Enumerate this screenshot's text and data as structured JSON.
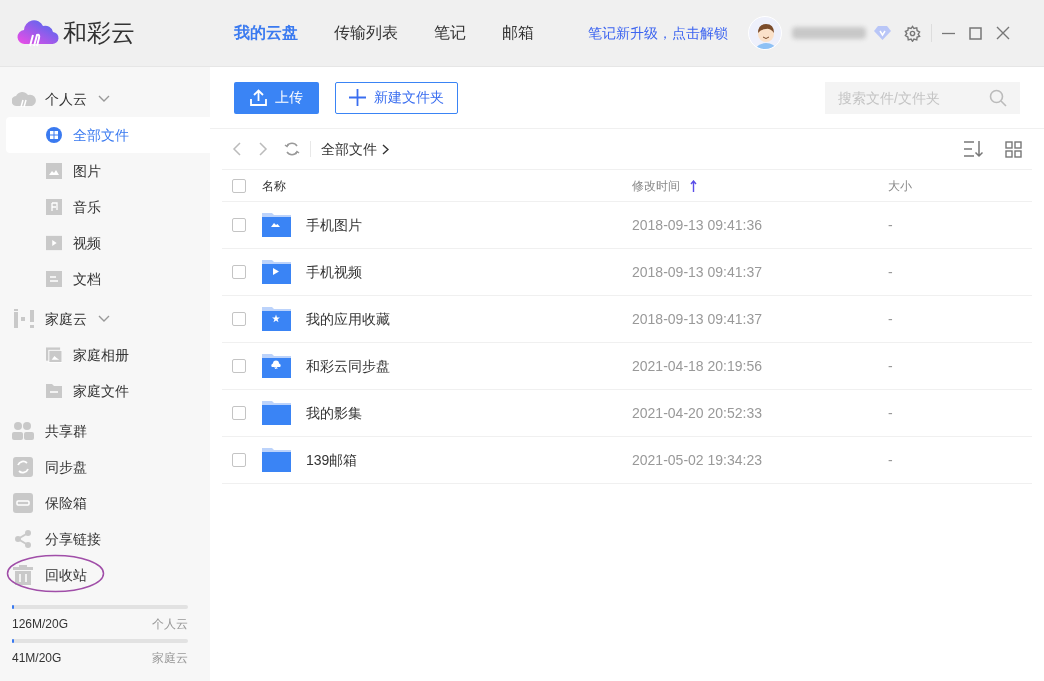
{
  "app": {
    "name": "和彩云"
  },
  "nav_tabs": [
    {
      "label": "我的云盘",
      "selected": true
    },
    {
      "label": "传输列表",
      "selected": false
    },
    {
      "label": "笔记",
      "selected": false
    },
    {
      "label": "邮箱",
      "selected": false
    }
  ],
  "promo_link": "笔记新升级，点击解锁",
  "sidebar": {
    "sections": [
      {
        "kind": "group",
        "label": "个人云",
        "expanded": true,
        "children": [
          {
            "label": "全部文件",
            "selected": true
          },
          {
            "label": "图片",
            "selected": false
          },
          {
            "label": "音乐",
            "selected": false
          },
          {
            "label": "视频",
            "selected": false
          },
          {
            "label": "文档",
            "selected": false
          }
        ]
      },
      {
        "kind": "group",
        "label": "家庭云",
        "expanded": true,
        "children": [
          {
            "label": "家庭相册",
            "selected": false
          },
          {
            "label": "家庭文件",
            "selected": false
          }
        ]
      },
      {
        "kind": "item",
        "label": "共享群",
        "selected": false
      },
      {
        "kind": "item",
        "label": "同步盘",
        "selected": false
      },
      {
        "kind": "item",
        "label": "保险箱",
        "selected": false
      },
      {
        "kind": "item",
        "label": "分享链接",
        "selected": false
      },
      {
        "kind": "item",
        "label": "回收站",
        "selected": false
      }
    ],
    "storage": [
      {
        "usage": "126M/20G",
        "label": "个人云",
        "level": 0.01
      },
      {
        "usage": "41M/20G",
        "label": "家庭云",
        "level": 0.01
      }
    ]
  },
  "select_all_checked": false,
  "toolbar": {
    "upload": "上传",
    "new_folder": "新建文件夹",
    "search": {
      "placeholder": "搜索文件/文件夹"
    }
  },
  "breadcrumb": "全部文件",
  "table": {
    "columns": [
      "名称",
      "修改时间",
      "大小"
    ],
    "rows": [
      {
        "name": "手机图片",
        "modified": "2018-09-13 09:41:36",
        "size": "-",
        "checked": false
      },
      {
        "name": "手机视频",
        "modified": "2018-09-13 09:41:37",
        "size": "-",
        "checked": false
      },
      {
        "name": "我的应用收藏",
        "modified": "2018-09-13 09:41:37",
        "size": "-",
        "checked": false
      },
      {
        "name": "和彩云同步盘",
        "modified": "2021-04-18 20:19:56",
        "size": "-",
        "checked": false
      },
      {
        "name": "我的影集",
        "modified": "2021-04-20 20:52:33",
        "size": "-",
        "checked": false
      },
      {
        "name": "139邮箱",
        "modified": "2021-05-02 19:34:23",
        "size": "-",
        "checked": false
      }
    ]
  }
}
